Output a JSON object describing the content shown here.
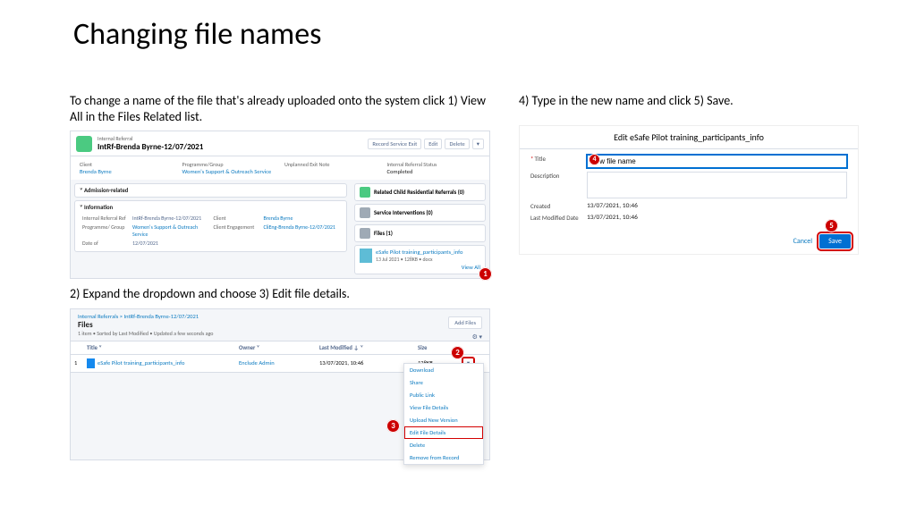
{
  "page": {
    "title": "Changing file names",
    "intro1": "To change a name of the file that's already uploaded onto the system click 1) View All in the Files Related list.",
    "intro2": "2) Expand the dropdown and choose 3) Edit file details.",
    "intro3": "4) Type in the new name and click 5) Save."
  },
  "callouts": {
    "c1": "1",
    "c2": "2",
    "c3": "3",
    "c4": "4",
    "c5": "5"
  },
  "shot1": {
    "kicker": "Internal Referral",
    "record_title": "IntRf-Brenda Byrne-12/07/2021",
    "buttons": {
      "record_exit": "Record Service Exit",
      "edit": "Edit",
      "delete": "Delete"
    },
    "fields": {
      "client_lbl": "Client",
      "client_val": "Brenda Byrne",
      "prog_lbl": "Programme/Group",
      "prog_val": "Women's Support & Outreach Service",
      "exit_lbl": "Unplanned Exit Note",
      "exit_val": "",
      "status_lbl": "Internal Referral Status",
      "status_val": "Completed"
    },
    "section_admission": "Admission-related",
    "section_info": "Information",
    "detail": {
      "ref_lbl": "Internal Referral Ref",
      "ref_val": "IntRf-Brenda Byrne-12/07/2021",
      "client_lbl": "Client",
      "client_val": "Brenda Byrne",
      "prog_lbl": "Programme/ Group",
      "prog_val": "Women's Support & Outreach Service",
      "eng_lbl": "Client Engagement",
      "eng_val": "CliEng-Brenda Byrne-12/07/2021",
      "date_lbl": "Date of",
      "date_val": "12/07/2021"
    },
    "side": {
      "child": "Related Child Residential Referrals (0)",
      "interventions": "Service Interventions (0)",
      "files_header": "Files (1)",
      "file_name": "eSafe Pilot training_participants_info",
      "file_meta": "13 Jul 2021 • 128KB • docx",
      "view_all": "View All"
    }
  },
  "shot2": {
    "crumb1": "Internal Referrals",
    "crumb_sep": " > ",
    "crumb2": "IntRf-Brenda Byrne-12/07/2021",
    "title": "Files",
    "subtitle": "1 item • Sorted by Last Modified • Updated a few seconds ago",
    "add_files": "Add Files",
    "cols": {
      "num": "",
      "title": "Title",
      "owner": "Owner",
      "modified": "Last Modified ↓",
      "size": "Size"
    },
    "row": {
      "num": "1",
      "title": "eSafe Pilot training_participants_info",
      "owner": "Enclude Admin",
      "modified": "13/07/2021, 10:46",
      "size": "128KB"
    },
    "menu": {
      "download": "Download",
      "share": "Share",
      "public": "Public Link",
      "view": "View File Details",
      "upload": "Upload New Version",
      "edit": "Edit File Details",
      "delete": "Delete",
      "remove": "Remove from Record"
    }
  },
  "shot3": {
    "modal_title": "Edit eSafe Pilot training_participants_info",
    "title_lbl": "Title",
    "title_val": "New file name",
    "desc_lbl": "Description",
    "created_lbl": "Created",
    "created_val": "13/07/2021, 10:46",
    "mod_lbl": "Last Modified Date",
    "mod_val": "13/07/2021, 10:46",
    "cancel": "Cancel",
    "save": "Save"
  }
}
